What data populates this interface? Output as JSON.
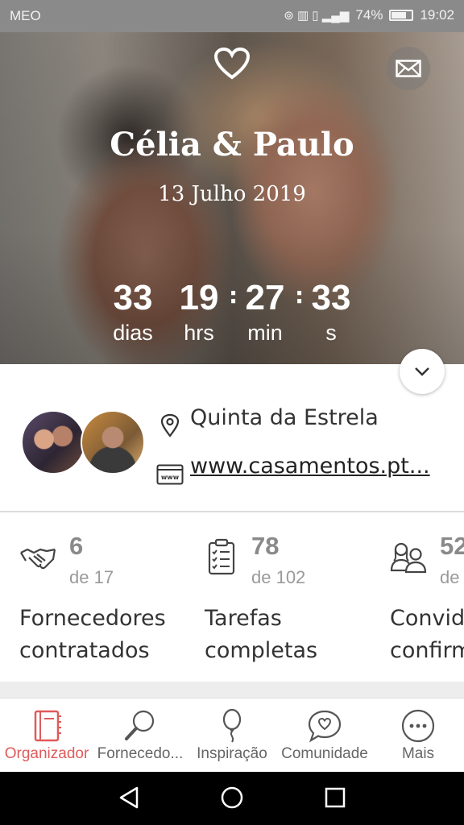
{
  "status_bar": {
    "carrier": "MEO",
    "battery": "74%",
    "time": "19:02"
  },
  "hero": {
    "names": "Célia & Paulo",
    "date": "13 Julho 2019",
    "countdown": [
      {
        "value": "33",
        "label": "dias"
      },
      {
        "value": "19",
        "label": "hrs"
      },
      {
        "value": "27",
        "label": "min"
      },
      {
        "value": "33",
        "label": "s"
      }
    ]
  },
  "info": {
    "venue": "Quinta da Estrela",
    "website": "www.casamentos.pt..."
  },
  "stats": [
    {
      "value": "6",
      "total": "de 17",
      "label_line1": "Fornecedores",
      "label_line2": "contratados",
      "icon": "handshake-icon"
    },
    {
      "value": "78",
      "total": "de 102",
      "label_line1": "Tarefas",
      "label_line2": "completas",
      "icon": "checklist-icon"
    },
    {
      "value": "52",
      "total": "de",
      "label_line1": "Convid",
      "label_line2": "confirm",
      "icon": "guests-icon"
    }
  ],
  "bottom_nav": [
    {
      "label": "Organizador",
      "icon": "notebook-icon",
      "active": true
    },
    {
      "label": "Fornecedo...",
      "icon": "magnifier-icon",
      "active": false
    },
    {
      "label": "Inspiração",
      "icon": "balloon-icon",
      "active": false
    },
    {
      "label": "Comunidade",
      "icon": "chat-heart-icon",
      "active": false
    },
    {
      "label": "Mais",
      "icon": "more-icon",
      "active": false
    }
  ],
  "colors": {
    "accent": "#e05a5a",
    "text": "#333333",
    "muted": "#8a8a8a"
  }
}
